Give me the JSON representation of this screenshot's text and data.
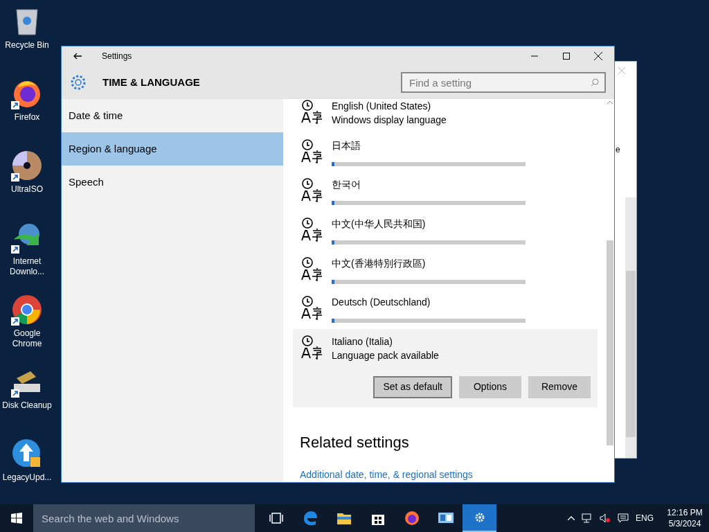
{
  "desktop_icons": [
    {
      "label": "Recycle Bin",
      "kind": "bin",
      "shortcut": false
    },
    {
      "label": "Firefox",
      "kind": "firefox",
      "shortcut": true
    },
    {
      "label": "UltraISO",
      "kind": "disc",
      "shortcut": true
    },
    {
      "label": "Internet Downlo...",
      "kind": "idm",
      "shortcut": true
    },
    {
      "label": "Google Chrome",
      "kind": "chrome",
      "shortcut": true
    },
    {
      "label": "Disk Cleanup",
      "kind": "cleanup",
      "shortcut": true
    },
    {
      "label": "LegacyUpd...",
      "kind": "update",
      "shortcut": false
    }
  ],
  "background_window": {
    "text": "e"
  },
  "window": {
    "title": "Settings",
    "section": "TIME & LANGUAGE",
    "search": {
      "placeholder": "Find a setting"
    }
  },
  "sidebar": {
    "items": [
      {
        "label": "Date & time",
        "selected": false
      },
      {
        "label": "Region & language",
        "selected": true
      },
      {
        "label": "Speech",
        "selected": false
      }
    ]
  },
  "languages": [
    {
      "name": "English (United States)",
      "kind": "text",
      "status": "Windows display language",
      "expanded": false
    },
    {
      "name": "日本語",
      "kind": "progress",
      "level": 0.015,
      "expanded": false
    },
    {
      "name": "한국어",
      "kind": "progress",
      "level": 0.015,
      "expanded": false
    },
    {
      "name": "中文(中华人民共和国)",
      "kind": "progress",
      "level": 0.015,
      "expanded": false
    },
    {
      "name": "中文(香港特別行政區)",
      "kind": "progress",
      "level": 0.015,
      "expanded": false
    },
    {
      "name": "Deutsch (Deutschland)",
      "kind": "progress",
      "level": 0.015,
      "expanded": false
    },
    {
      "name": "Italiano (Italia)",
      "kind": "text",
      "status": "Language pack available",
      "expanded": true,
      "buttons": [
        {
          "label": "Set as default",
          "selected": true
        },
        {
          "label": "Options",
          "selected": false
        },
        {
          "label": "Remove",
          "selected": false
        }
      ]
    }
  ],
  "related": {
    "heading": "Related settings",
    "link": "Additional date, time, & regional settings"
  },
  "taskbar": {
    "search": {
      "placeholder": "Search the web and Windows"
    },
    "apps": [
      {
        "kind": "taskview",
        "active": false
      },
      {
        "kind": "edge",
        "active": false
      },
      {
        "kind": "folder",
        "active": false
      },
      {
        "kind": "store",
        "active": false
      },
      {
        "kind": "firefox",
        "active": false
      },
      {
        "kind": "control",
        "active": false
      },
      {
        "kind": "settings",
        "active": true
      }
    ],
    "language": "ENG",
    "time": "12:16 PM",
    "date": "5/3/2024"
  }
}
